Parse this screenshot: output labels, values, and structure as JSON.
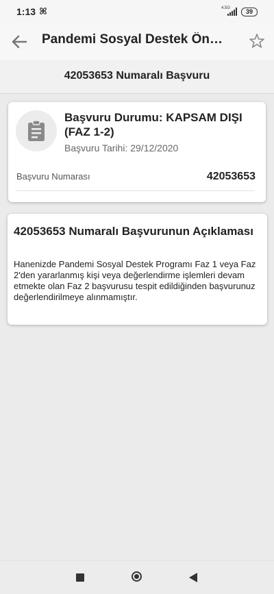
{
  "status_bar": {
    "time": "1:13",
    "network": "4.5G",
    "battery": "39",
    "icons": [
      "pinwheel-icon",
      "signal-icon",
      "battery-icon"
    ]
  },
  "app_bar": {
    "title": "Pandemi Sosyal Destek Ön…",
    "icons": [
      "back-arrow-icon",
      "star-outline-icon"
    ]
  },
  "subheader": {
    "title": "42053653 Numaralı Başvuru"
  },
  "status_card": {
    "icon": "clipboard-icon",
    "status_title": "Başvuru Durumu: KAPSAM DIŞI (FAZ 1-2)",
    "date_text": "Başvuru Tarihi: 29/12/2020",
    "number_label": "Başvuru Numarası",
    "number_value": "42053653"
  },
  "explanation_card": {
    "title": "42053653 Numaralı Başvurunun Açıklaması",
    "body": "Hanenizde Pandemi Sosyal Destek Programı Faz 1 veya Faz 2'den yararlanmış kişi veya değerlendirme işlemleri devam etmekte olan Faz 2 başvurusu tespit edildiğinden başvurunuz değerlendirilmeye alınmamıştır."
  },
  "nav_bar": {
    "icons": [
      "recent-apps-icon",
      "home-icon",
      "back-triangle-icon"
    ]
  },
  "colors": {
    "background": "#ebebeb",
    "card": "#ffffff",
    "text": "#222222",
    "muted": "#666666",
    "icon": "#8a8a8a"
  }
}
